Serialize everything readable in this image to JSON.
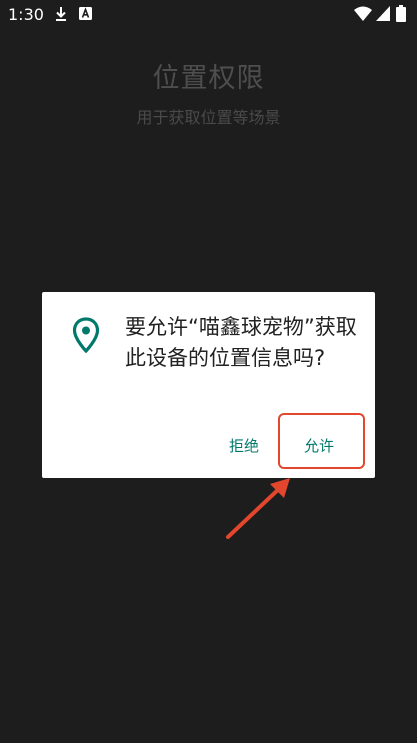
{
  "status_bar": {
    "time": "1:30",
    "icons": [
      "download-icon",
      "a-icon",
      "wifi-icon",
      "signal-icon",
      "battery-icon"
    ]
  },
  "background_page": {
    "title": "位置权限",
    "subtitle": "用于获取位置等场景"
  },
  "permission_dialog": {
    "icon": "location-pin-icon",
    "message": "要允许“喵鑫球宠物”获取此设备的位置信息吗?",
    "deny_label": "拒绝",
    "allow_label": "允许"
  },
  "annotation": {
    "highlight_color": "#e2462d",
    "arrow_target": "allow-button"
  },
  "colors": {
    "background": "#1d1d1d",
    "accent": "#00796b",
    "dialog": "#ffffff"
  }
}
